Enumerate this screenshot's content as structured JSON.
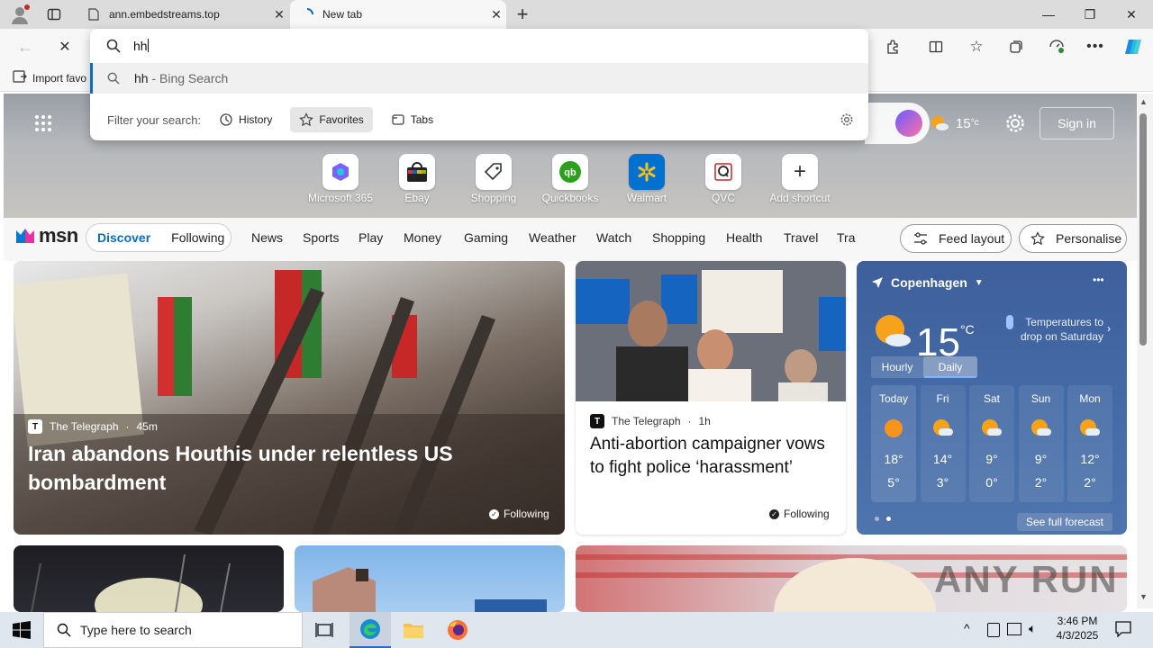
{
  "browser": {
    "tabs": [
      {
        "title": "ann.embedstreams.top"
      },
      {
        "title": "New tab"
      }
    ],
    "favorites_bar": {
      "import_label": "Import favo"
    }
  },
  "omnibox": {
    "query": "hh",
    "suggestion": {
      "term": "hh",
      "suffix": " - Bing Search"
    },
    "filter": {
      "label": "Filter your search:",
      "options": [
        "History",
        "Favorites",
        "Tabs"
      ],
      "selected": "Favorites"
    }
  },
  "msn_header": {
    "temp": "15",
    "temp_unit": "°c",
    "sign_in": "Sign in"
  },
  "shortcuts": [
    "Microsoft 365",
    "Ebay",
    "Shopping",
    "Quickbooks",
    "Walmart",
    "QVC",
    "Add shortcut"
  ],
  "nav": {
    "logo": "msn",
    "tabs": [
      "Discover",
      "Following"
    ],
    "categories": [
      "News",
      "Sports",
      "Play",
      "Money",
      "Gaming",
      "Weather",
      "Watch",
      "Shopping",
      "Health",
      "Travel",
      "Tra"
    ],
    "feed_layout": "Feed layout",
    "personalise": "Personalise"
  },
  "feed": {
    "lead": {
      "source": "The Telegraph",
      "age": "45m",
      "headline": "Iran abandons Houthis under relentless US bombardment",
      "following": "Following"
    },
    "second": {
      "source": "The Telegraph",
      "age": "1h",
      "headline": "Anti-abortion campaigner vows to fight police ‘harassment’",
      "following": "Following"
    }
  },
  "weather": {
    "location": "Copenhagen",
    "temp": "15",
    "unit": "°C",
    "alert": "Temperatures to drop on Saturday",
    "tabs": [
      "Hourly",
      "Daily"
    ],
    "selected_tab": "Daily",
    "days": [
      {
        "day": "Today",
        "high": "18°",
        "low": "5°"
      },
      {
        "day": "Fri",
        "high": "14°",
        "low": "3°"
      },
      {
        "day": "Sat",
        "high": "9°",
        "low": "0°"
      },
      {
        "day": "Sun",
        "high": "9°",
        "low": "2°"
      },
      {
        "day": "Mon",
        "high": "12°",
        "low": "2°"
      }
    ],
    "see_full": "See full forecast"
  },
  "watermark": "ANY RUN",
  "taskbar": {
    "search_placeholder": "Type here to search",
    "time": "3:46 PM",
    "date": "4/3/2025"
  }
}
